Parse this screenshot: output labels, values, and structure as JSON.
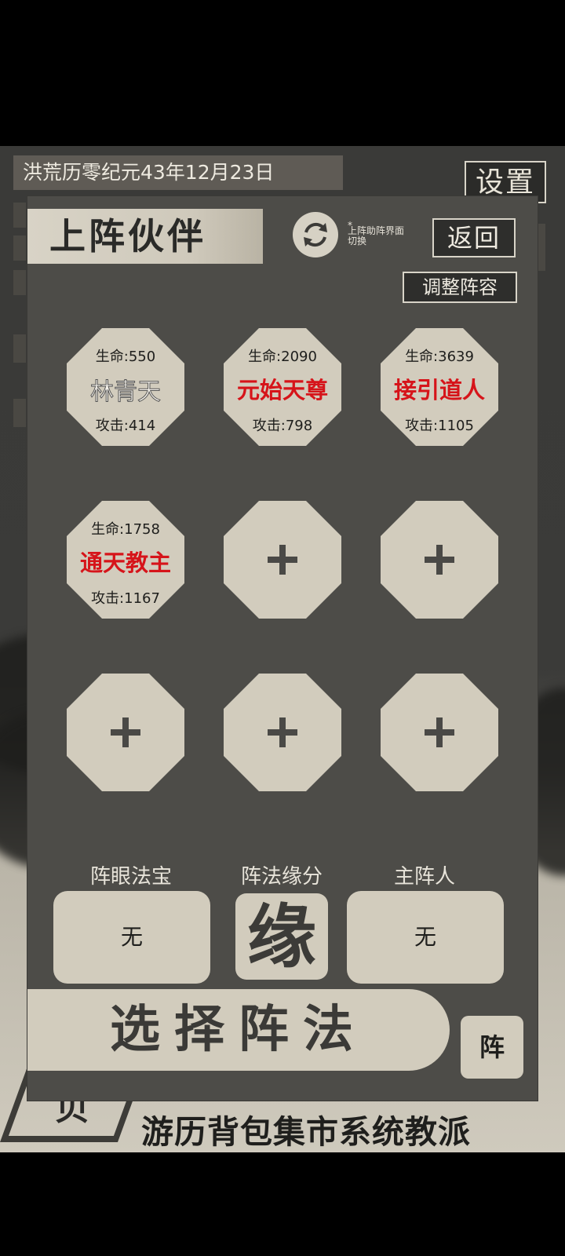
{
  "date": "洪荒历零纪元43年12月23日",
  "settings_label": "设置",
  "panel": {
    "title": "上阵伙伴",
    "switch_star": "*",
    "switch_note": "上阵助阵界面切换",
    "back_label": "返回",
    "adjust_label": "调整阵容"
  },
  "partners": [
    {
      "hp": "生命:550",
      "name": "林青天",
      "atk": "攻击:414",
      "name_color": "#f4f1ea"
    },
    {
      "hp": "生命:2090",
      "name": "元始天尊",
      "atk": "攻击:798",
      "name_color": "#d6141a"
    },
    {
      "hp": "生命:3639",
      "name": "接引道人",
      "atk": "攻击:1105",
      "name_color": "#d6141a"
    },
    {
      "hp": "生命:1758",
      "name": "通天教主",
      "atk": "攻击:1167",
      "name_color": "#d6141a"
    }
  ],
  "fields": {
    "treasure_label": "阵眼法宝",
    "treasure_value": "无",
    "fate_label": "阵法缘分",
    "fate_char": "缘",
    "leader_label": "主阵人",
    "leader_value": "无"
  },
  "select_label": "选择阵法",
  "formation_label": "阵",
  "bottom_nav": "游历背包集市系统教派",
  "bottom_deco": "贝"
}
